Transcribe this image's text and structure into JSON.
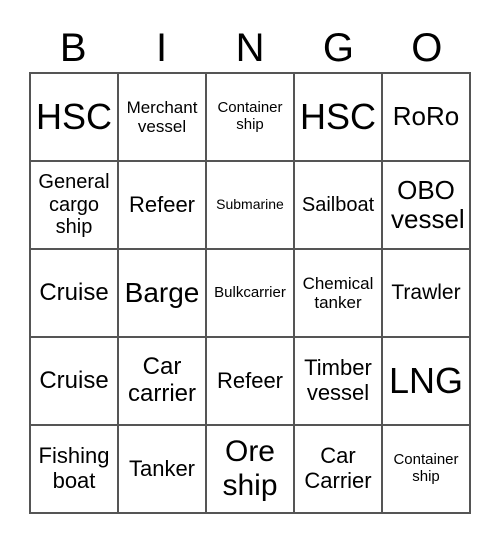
{
  "header": [
    "B",
    "I",
    "N",
    "G",
    "O"
  ],
  "cells": [
    "HSC",
    "Merchant vessel",
    "Container ship",
    "HSC",
    "RoRo",
    "General cargo ship",
    "Refeer",
    "Submarine",
    "Sailboat",
    "OBO vessel",
    "Cruise",
    "Barge",
    "Bulkcarrier",
    "Chemical tanker",
    "Trawler",
    "Cruise",
    "Car carrier",
    "Refeer",
    "Timber vessel",
    "LNG",
    "Fishing boat",
    "Tanker",
    "Ore ship",
    "Car Carrier",
    "Container ship"
  ]
}
